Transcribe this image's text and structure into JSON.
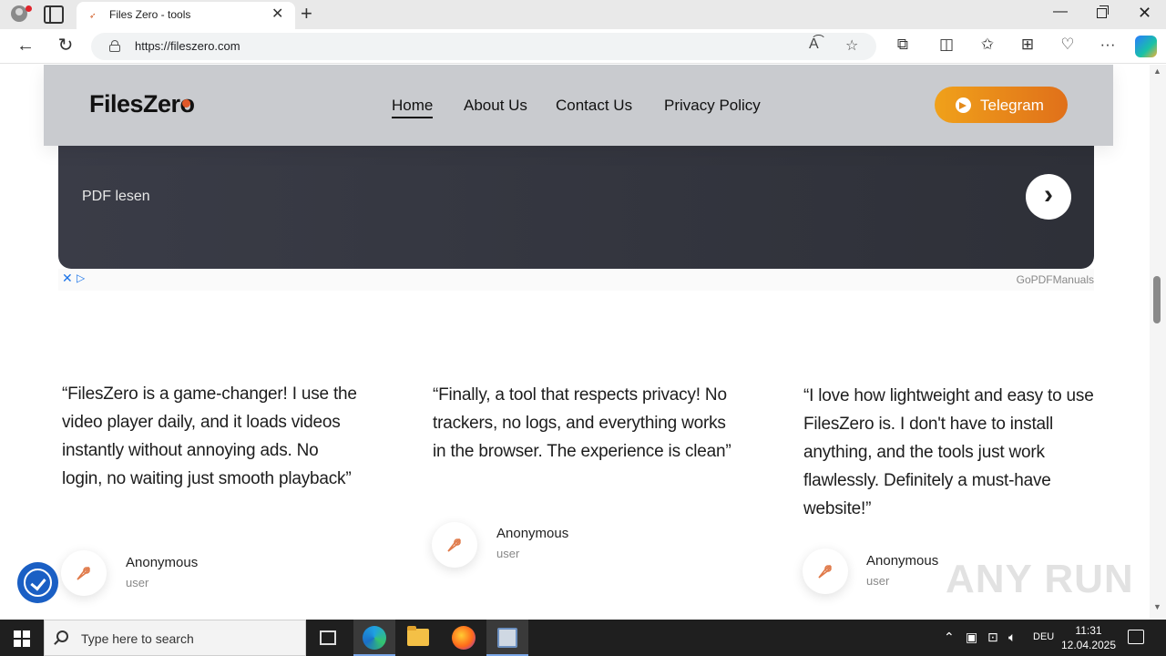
{
  "browser": {
    "tab_title": "Files Zero - tools",
    "url": "https://fileszero.com"
  },
  "header": {
    "logo_text": "FilesZero",
    "nav": [
      {
        "label": "Home"
      },
      {
        "label": "About Us"
      },
      {
        "label": "Contact Us"
      },
      {
        "label": "Privacy Policy"
      }
    ],
    "telegram_label": "Telegram"
  },
  "ad": {
    "text": "PDF lesen",
    "brand": "GoPDFManuals"
  },
  "testimonials": [
    {
      "quote": "“FilesZero is a game-changer! I use the video player daily, and it loads videos instantly without annoying ads. No login, no waiting just smooth playback”",
      "name": "Anonymous",
      "role": "user"
    },
    {
      "quote": "“Finally, a tool that respects privacy! No trackers, no logs, and everything works in the browser. The experience is clean”",
      "name": "Anonymous",
      "role": "user"
    },
    {
      "quote": "“I love how lightweight and easy to use FilesZero is. I don't have to install anything, and the tools just work flawlessly. Definitely a must-have website!”",
      "name": "Anonymous",
      "role": "user"
    }
  ],
  "watermark": "ANY RUN",
  "taskbar": {
    "search_placeholder": "Type here to search",
    "language": "DEU",
    "time": "11:31",
    "date": "12.04.2025"
  },
  "colors": {
    "accent_orange": "#e0701a",
    "header_bg": "#c9cbcf",
    "ad_bg": "#33353e"
  }
}
